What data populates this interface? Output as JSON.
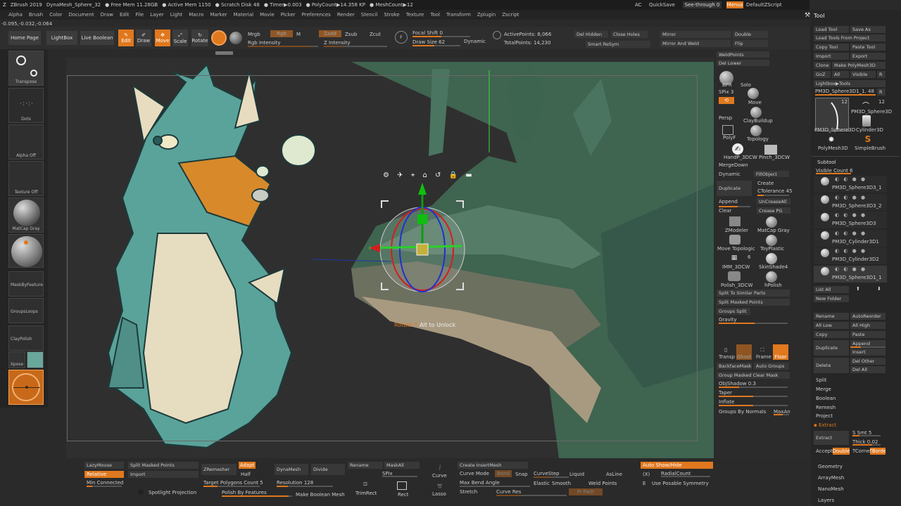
{
  "titlebar": {
    "app": "ZBrush 2019",
    "doc": "DynaMesh_Sphere_32",
    "stats": [
      "● Free Mem 11.28GB",
      "● Active Mem 1150",
      "● Scratch Disk 48",
      "● Timer▶0.003",
      "● PolyCount▶14.358 KP",
      "● MeshCount▶12"
    ],
    "ac": "AC",
    "quicksave": "QuickSave",
    "seethrough": "See-through",
    "seethrough_val": "0",
    "menus_btn": "Menus",
    "script": "DefaultZScript"
  },
  "menubar": [
    "Alpha",
    "Brush",
    "Color",
    "Document",
    "Draw",
    "Edit",
    "File",
    "Layer",
    "Light",
    "Macro",
    "Marker",
    "Material",
    "Movie",
    "Picker",
    "Preferences",
    "Render",
    "Stencil",
    "Stroke",
    "Texture",
    "Tool",
    "Transform",
    "Zplugin",
    "Zscript"
  ],
  "coords": "-0.095,-0.032,-0.064",
  "toolbar": {
    "home": "Home Page",
    "lightbox": "LightBox",
    "liveboolean": "Live Boolean",
    "edit": "Edit",
    "draw": "Draw",
    "move": "Move",
    "scale": "Scale",
    "rotate": "Rotate",
    "mrgb": "Mrgb",
    "rgb": "Rgb",
    "m": "M",
    "zadd": "Zadd",
    "zsub": "Zsub",
    "zcut": "Zcut",
    "rgb_intensity": "Rgb Intensity",
    "z_intensity": "Z Intensity",
    "focal_shift": "Focal Shift",
    "focal_val": "0",
    "draw_size": "Draw Size",
    "draw_val": "62",
    "dynamic": "Dynamic",
    "active_points": "ActivePoints: 8,066",
    "total_points": "TotalPoints: 14,230",
    "del_hidden": "Del Hidden",
    "close_holes": "Close Holes",
    "smart_resym": "Smart ReSym",
    "mirror": "Mirror",
    "mirror_weld": "Mirror And Weld",
    "double": "Double",
    "flip": "Flip"
  },
  "leftshelf": {
    "transpose": "Transpose",
    "dots": "Dots",
    "alpha_off": "Alpha Off",
    "texture_off": "Texture Off",
    "matcap": "MatCap Gray",
    "mask_feature": "MaskByFeature",
    "groups_loops": "GroupsLoops",
    "claypolish": "ClayPolish",
    "xpose": "Xpose"
  },
  "viewport": {
    "hint_key": "Rotate Y",
    "hint_rest": "Alt to Unlock"
  },
  "rightpanel": {
    "weldpoints": "WeldPoints",
    "del_lower": "Del Lower",
    "bpr": "BPR",
    "spix": "SPix",
    "spix_val": "3",
    "solo": "Solo",
    "move": "Move",
    "persp": "Persp",
    "claybuildup": "ClayBuildup",
    "polyf": "PolyF",
    "topology": "Topology",
    "handp": "HandP_3DCW",
    "pinch": "Pinch_3DCW",
    "mergedown": "MergeDown",
    "dynamic": "Dynamic",
    "fillobject": "FillObject",
    "duplicate": "Duplicate",
    "create": "Create",
    "ctolerance": "CTolerance",
    "ctol_val": "45",
    "append": "Append",
    "uncreaseall": "UnCreaseAll",
    "clear": "Clear",
    "crease_pg": "Crease PG",
    "zmodeler": "ZModeler",
    "matcap": "MatCap Gray",
    "move_topo": "Move Topologic",
    "toyplastic": "ToyPlastic",
    "imm": "IMM_3DCW",
    "imm_num": "6",
    "skinshade": "SkinShade4",
    "polish": "Polish_3DCW",
    "hpolish": "hPolish",
    "split_similar": "Split To Similar Parts",
    "split_masked": "Split Masked Points",
    "groups_split": "Groups Split",
    "gravity": "Gravity",
    "transp": "Transp",
    "ghost": "Ghost",
    "frame": "Frame",
    "floor": "Floor",
    "backfacemask": "BackfaceMask",
    "auto_groups": "Auto Groups",
    "group_masked": "Group Masked Clear Mask",
    "objshadow": "ObjShadow",
    "objshadow_val": "0.3",
    "taper": "Taper",
    "inflate": "Inflate",
    "groups_normals": "Groups By Normals",
    "maxan": "MaxAn"
  },
  "toolpanel": {
    "title": "Tool",
    "load_tool": "Load Tool",
    "save_as": "Save As",
    "load_project": "Load Tools From Project",
    "copy_tool": "Copy Tool",
    "paste_tool": "Paste Tool",
    "import": "Import",
    "export": "Export",
    "clone": "Clone",
    "make_polymesh": "Make PolyMesh3D",
    "goz": "GoZ",
    "all": "All",
    "visible": "Visible",
    "r": "R",
    "lightbox_tools": "Lightbox▶Tools",
    "current_tool": "PM3D_Sphere3D1_1.",
    "current_val": "48",
    "thumb_num1": "12",
    "thumb_num2": "12",
    "thumb1": "PM3D_Sphere3D",
    "thumb2": "PM3D_Sphere3D",
    "thumb3": "Cylinder3D",
    "thumb4": "PolyMesh3D",
    "thumb5": "SimpleBrush",
    "subtool": "Subtool",
    "visible_count": "Visible Count",
    "visible_count_val": "6",
    "subtools": [
      "PM3D_Sphere3D3_1",
      "PM3D_Sphere3D3_2",
      "PM3D_Sphere3D3",
      "PM3D_Cylinder3D1",
      "PM3D_Cylinder3D2",
      "PM3D_Sphere3D1_1"
    ],
    "list_all": "List All",
    "new_folder": "New Folder",
    "rename": "Rename",
    "autoreorder": "AutoReorder",
    "all_low": "All Low",
    "all_high": "All High",
    "copy": "Copy",
    "paste": "Paste",
    "duplicate": "Duplicate",
    "append": "Append",
    "insert": "Insert",
    "delete": "Delete",
    "del_other": "Del Other",
    "del_all": "Del All",
    "split": "Split",
    "merge": "Merge",
    "boolean": "Boolean",
    "remesh": "Remesh",
    "project": "Project",
    "extract_hdr": "▪ Extract",
    "extract": "Extract",
    "s_smt": "S Smt",
    "s_smt_val": "5",
    "thick": "Thick",
    "thick_val": "0.02",
    "accept": "Accept",
    "double": "Double",
    "tcorne": "TCorne",
    "tborder": "TBorde",
    "geometry": "Geometry",
    "arraymesh": "ArrayMesh",
    "nanomesh": "NanoMesh",
    "layers": "Layers"
  },
  "bottombar": {
    "lazymouse": "LazyMouse",
    "relative": "Relative",
    "min_connected": "Min Connected",
    "split_masked": "Split Masked Points",
    "import": "Import",
    "spotlight": "Spotlight Projection",
    "zremesher": "ZRemesher",
    "adapt": "Adapt",
    "half": "Half",
    "target_polys": "Target Polygons Count",
    "target_val": "5",
    "polish_features": "Polish By Features",
    "dynamesh": "DynaMesh",
    "divide": "Divide",
    "resolution": "Resolution",
    "res_val": "128",
    "rename": "Rename",
    "maskall": "MaskAll",
    "spix": "SPix",
    "make_boolean": "Make Boolean Mesh",
    "curve": "Curve",
    "lasso": "Lasso",
    "trimrect": "TrimRect",
    "rect": "Rect",
    "create_insert": "Create InsertMesh",
    "curve_mode": "Curve Mode",
    "bend": "Bend",
    "snap": "Snap",
    "curvestep": "CurveStep",
    "liquid": "Liquid",
    "asline": "AsLine",
    "max_bend": "Max Bend Angle",
    "elastic": "Elastic",
    "smooth": "Smooth",
    "weld_points": "Weld Points",
    "stretch": "Stretch",
    "curve_res": "Curve Res",
    "fr_path": "Fr Path",
    "auto_show": "Auto Show/Hide",
    "x": "(X)",
    "radialcount": "RadialCount",
    "e": "E",
    "use_posable": "Use Posable Symmetry"
  }
}
